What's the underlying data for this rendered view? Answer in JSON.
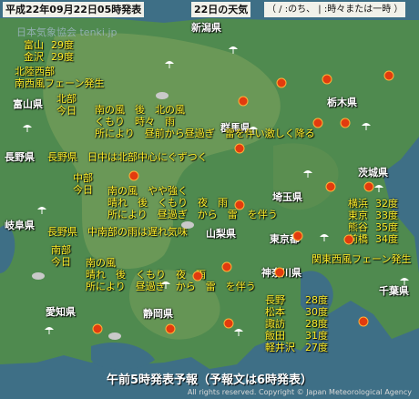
{
  "header": {
    "date": "平成22年09月22日05時発表",
    "heading": "22日の天気",
    "legend": "（ / :のち、 | :時々または一時 ）"
  },
  "watermark": "日本気象協会 tenki.jp",
  "prefectures": {
    "niigata": "新潟県",
    "toyama": "富山県",
    "gunma": "群馬県",
    "tochigi": "栃木県",
    "ibaraki": "茨城県",
    "saitama": "埼玉県",
    "tokyo": "東京都",
    "kanagawa": "神奈川県",
    "chiba": "千葉県",
    "nagano": "長野県",
    "gifu": "岐阜県",
    "yamanashi": "山梨県",
    "aichi": "愛知県",
    "shizuoka": "静岡県"
  },
  "temps_west": [
    {
      "city": "富山",
      "value": "29度"
    },
    {
      "city": "金沢",
      "value": "29度"
    }
  ],
  "temps_east": [
    {
      "city": "横浜",
      "value": "32度"
    },
    {
      "city": "東京",
      "value": "33度"
    },
    {
      "city": "熊谷",
      "value": "35度"
    },
    {
      "city": "前橋",
      "value": "34度"
    }
  ],
  "temps_south": [
    {
      "city": "長野",
      "value": "28度"
    },
    {
      "city": "松本",
      "value": "30度"
    },
    {
      "city": "諏訪",
      "value": "28度"
    },
    {
      "city": "飯田",
      "value": "31度"
    },
    {
      "city": "軽井沢",
      "value": "27度"
    }
  ],
  "forecast": {
    "hokuriku_l1": "北陸西部",
    "hokuriku_l2": "南西風フェーン発生",
    "north_label1": "北部",
    "north_label2": "今日",
    "north_l1": "南の風　後　北の風",
    "north_l2": "くもり　時々　雨",
    "north_l3": "所により　昼前から昼過ぎ　雷を伴い激しく降る",
    "nagano_note": "長野県　日中は北部中心にぐずつく",
    "mid_label1": "中部",
    "mid_label2": "今日",
    "mid_l1": "南の風　やや強く",
    "mid_l2": "晴れ　後　くもり　夜　雨",
    "mid_l3": "所により　昼過ぎ　から　雷　を伴う",
    "south_note": "長野県　中南部の雨は遅れ気味",
    "south_label1": "南部",
    "south_label2": "今日",
    "south_l1": "南の風",
    "south_l2": "晴れ　後　くもり　夜　雨",
    "south_l3": "所により　昼過ぎ　から　雷　を伴う",
    "kanto_note": "関東西風フェーン発生"
  },
  "title": "午前5時発表予報（予報文は6時発表）",
  "copyright": "All rights reserved. Copyright © Japan Meteorological Agency",
  "colors": {
    "sea": "#3e6f86",
    "land": "#4f8a4f",
    "mountain": "#6f9a58",
    "text_yellow": "#ffef2a",
    "sun": "#e23b0e"
  }
}
